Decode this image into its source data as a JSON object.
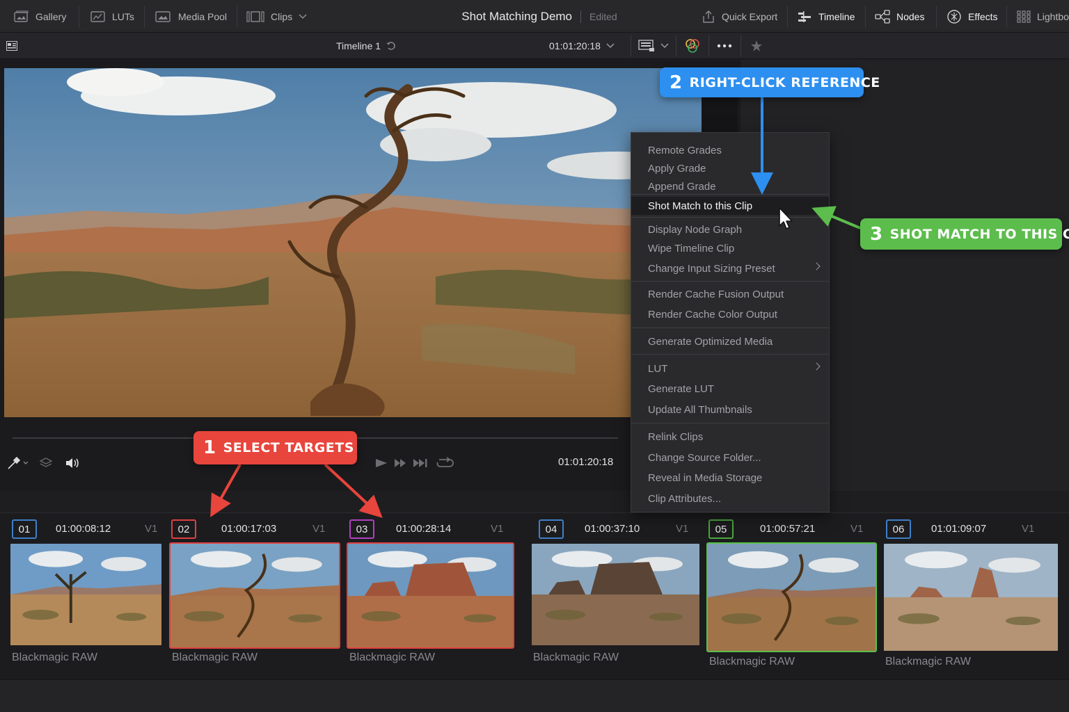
{
  "topbar": {
    "gallery": "Gallery",
    "luts": "LUTs",
    "media_pool": "Media Pool",
    "clips": "Clips",
    "project_title": "Shot Matching Demo",
    "project_state": "Edited",
    "quick_export": "Quick Export",
    "timeline": "Timeline",
    "nodes": "Nodes",
    "effects": "Effects",
    "lightbox": "Lightbo"
  },
  "viewer_bar": {
    "timeline_name": "Timeline 1",
    "timecode": "01:01:20:18"
  },
  "transport": {
    "timecode": "01:01:20:18"
  },
  "context_menu": {
    "items": [
      {
        "label": "Remote Grades"
      },
      {
        "label": "Apply Grade"
      },
      {
        "label": "Append Grade"
      },
      {
        "label": "Shot Match to this Clip",
        "highlighted": true
      },
      {
        "label": "Display Node Graph"
      },
      {
        "label": "Wipe Timeline Clip"
      },
      {
        "label": "Change Input Sizing Preset",
        "submenu": true
      },
      {
        "label": "Render Cache Fusion Output"
      },
      {
        "label": "Render Cache Color Output"
      },
      {
        "label": "Generate Optimized Media"
      },
      {
        "label": "LUT",
        "submenu": true
      },
      {
        "label": "Generate LUT"
      },
      {
        "label": "Update All Thumbnails"
      },
      {
        "label": "Relink Clips"
      },
      {
        "label": "Change Source Folder..."
      },
      {
        "label": "Reveal in Media Storage"
      },
      {
        "label": "Clip Attributes..."
      }
    ]
  },
  "clips": [
    {
      "num": "01",
      "timecode": "01:00:08:12",
      "track": "V1",
      "codec": "Blackmagic RAW",
      "border": "#3f7fc8",
      "thumb_border": "none"
    },
    {
      "num": "02",
      "timecode": "01:00:17:03",
      "track": "V1",
      "codec": "Blackmagic RAW",
      "border": "#e04040",
      "thumb_border": "#e04040"
    },
    {
      "num": "03",
      "timecode": "01:00:28:14",
      "track": "V1",
      "codec": "Blackmagic RAW",
      "border": "#b040c0",
      "thumb_border": "#e04040"
    },
    {
      "num": "04",
      "timecode": "01:00:37:10",
      "track": "V1",
      "codec": "Blackmagic RAW",
      "border": "#3f7fc8",
      "thumb_border": "none"
    },
    {
      "num": "05",
      "timecode": "01:00:57:21",
      "track": "V1",
      "codec": "Blackmagic RAW",
      "border": "#4aa83a",
      "thumb_border": "#5cc04a"
    },
    {
      "num": "06",
      "timecode": "01:01:09:07",
      "track": "V1",
      "codec": "Blackmagic RAW",
      "border": "#3f7fc8",
      "thumb_border": "none"
    }
  ],
  "callouts": {
    "step1_num": "1",
    "step1_text": "SELECT TARGETS",
    "step1_color": "#e8453c",
    "step2_num": "2",
    "step2_text": "RIGHT-CLICK REFERENCE",
    "step2_color": "#2d8ff0",
    "step3_num": "3",
    "step3_text": "SHOT MATCH TO THIS CLIP",
    "step3_color": "#5cbd4c"
  }
}
